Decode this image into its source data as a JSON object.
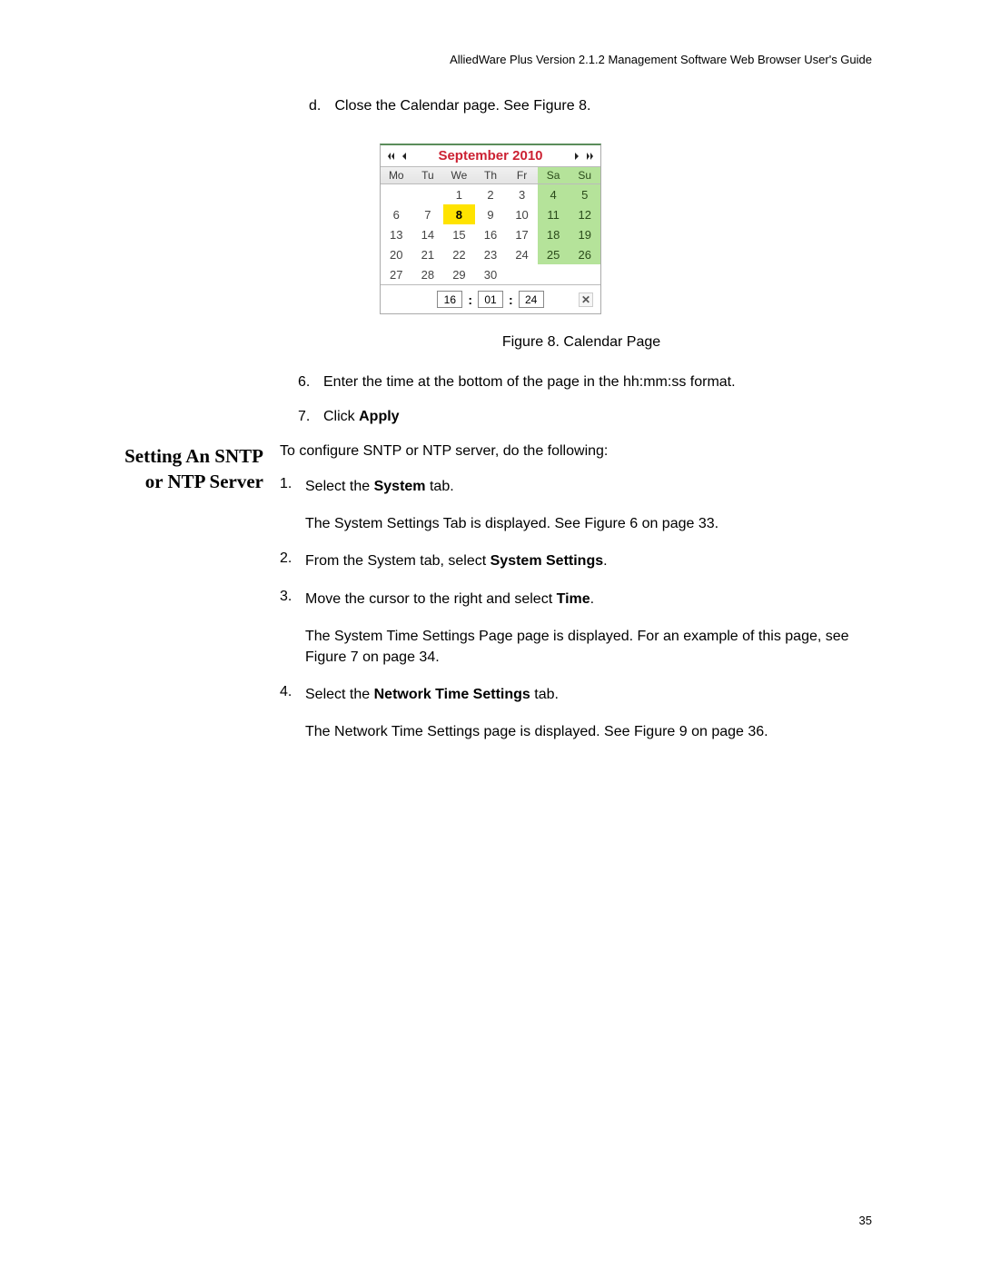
{
  "header": "AlliedWare Plus Version 2.1.2 Management Software Web Browser User's Guide",
  "step_d": {
    "letter": "d.",
    "text": "Close the Calendar page. See Figure 8."
  },
  "calendar": {
    "title": "September 2010",
    "dow": [
      "Mo",
      "Tu",
      "We",
      "Th",
      "Fr",
      "Sa",
      "Su"
    ],
    "grid": [
      [
        "",
        "",
        "1",
        "2",
        "3",
        "4",
        "5"
      ],
      [
        "6",
        "7",
        "8",
        "9",
        "10",
        "11",
        "12"
      ],
      [
        "13",
        "14",
        "15",
        "16",
        "17",
        "18",
        "19"
      ],
      [
        "20",
        "21",
        "22",
        "23",
        "24",
        "25",
        "26"
      ],
      [
        "27",
        "28",
        "29",
        "30",
        "",
        "",
        ""
      ]
    ],
    "today": "8",
    "time": {
      "hh": "16",
      "mm": "01",
      "ss": "24"
    }
  },
  "figure_caption": "Figure 8. Calendar Page",
  "step6": {
    "n": "6.",
    "text": "Enter the time at the bottom of the page in the hh:mm:ss format."
  },
  "step7": {
    "n": "7.",
    "pre": "Click ",
    "bold": "Apply"
  },
  "section_title_l1": "Setting An SNTP",
  "section_title_l2": "or NTP Server",
  "intro": "To configure SNTP or NTP server, do the following:",
  "s1": {
    "n": "1.",
    "pre": "Select the ",
    "bold": "System",
    "post": " tab."
  },
  "s1_sub": "The System Settings Tab is displayed. See Figure 6 on page 33.",
  "s2": {
    "n": "2.",
    "pre": "From the System tab, select ",
    "bold": "System Settings",
    "post": "."
  },
  "s3": {
    "n": "3.",
    "pre": "Move the cursor to the right and select ",
    "bold": "Time",
    "post": "."
  },
  "s3_sub": "The System Time Settings Page page is displayed. For an example of this page, see Figure 7 on page 34.",
  "s4": {
    "n": "4.",
    "pre": "Select the ",
    "bold": "Network Time Settings",
    "post": " tab."
  },
  "s4_sub": "The Network Time Settings page is displayed. See Figure 9 on page 36.",
  "page_num": "35"
}
